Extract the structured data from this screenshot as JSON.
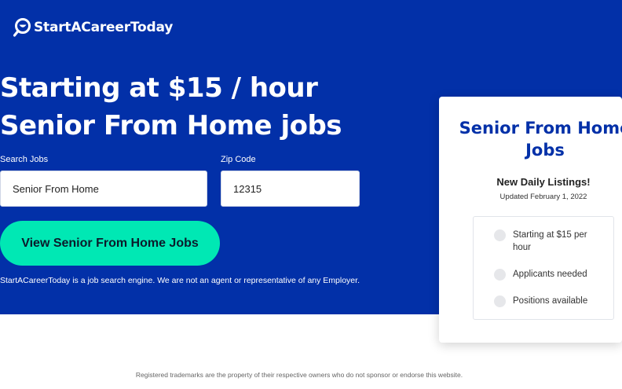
{
  "brand": {
    "name": "StartACareerToday"
  },
  "hero": {
    "headline_line1": "Starting at $15 / hour",
    "headline_line2": "Senior From Home jobs",
    "search_label": "Search Jobs",
    "search_value": "Senior From Home",
    "zip_label": "Zip Code",
    "zip_value": "12315",
    "cta_label": "View Senior From Home Jobs",
    "disclaimer": "StartACareerToday is a job search engine. We are not an agent or representative of any Employer."
  },
  "card": {
    "title": "Senior From Home Jobs",
    "subtitle": "New Daily Listings!",
    "updated": "Updated February 1, 2022",
    "items": [
      {
        "label": "Starting at $15 per hour"
      },
      {
        "label": "Applicants needed"
      },
      {
        "label": "Positions available"
      }
    ]
  },
  "footer": {
    "note": "Registered trademarks are the property of their respective owners who do not sponsor or endorse this website."
  },
  "colors": {
    "hero_bg": "#0230a8",
    "cta_bg": "#00e8b4",
    "card_title": "#0230a8"
  },
  "icons": {
    "logo": "magnifier-smile-icon",
    "list_bullet": "circle-bullet-icon"
  }
}
